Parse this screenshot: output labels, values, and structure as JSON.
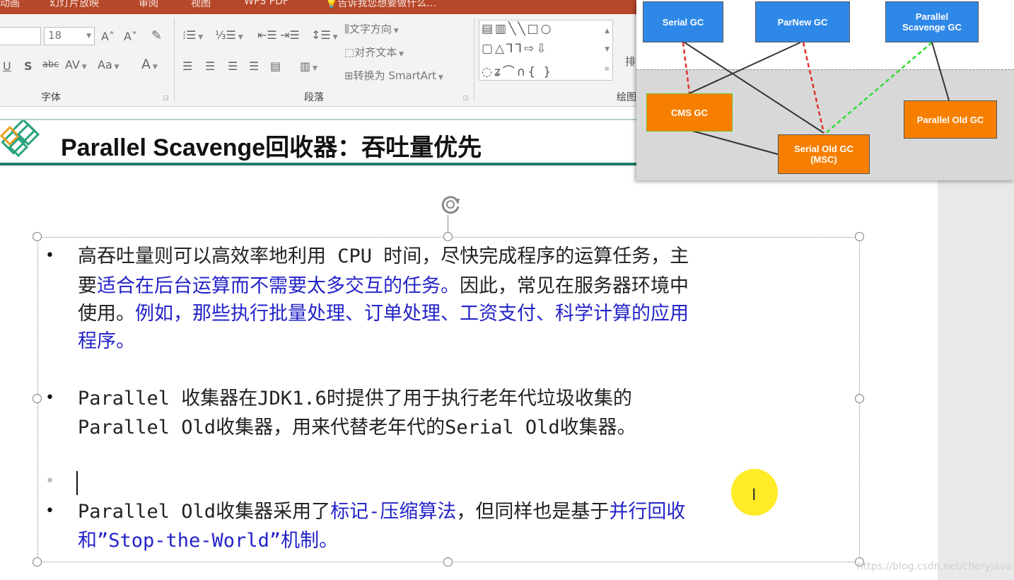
{
  "ribbon": {
    "tabs": [
      "动画",
      "幻灯片放映",
      "审阅",
      "视图",
      "WPS PDF",
      "告诉我您想要做什么..."
    ],
    "font_size": "18",
    "text_direction_label": "文字方向",
    "align_text_label": "对齐文本",
    "smartart_label": "转换为 SmartArt",
    "arrange_label_partial": "排",
    "groups": {
      "font": "字体",
      "paragraph": "段落",
      "drawing_partial": "绘图"
    },
    "font_glyphs": {
      "grow": "A˄",
      "shrink": "A˅",
      "underline": "U",
      "shadow": "S",
      "strike": "abc",
      "spacing": "AV",
      "case": "Aa",
      "color": "A"
    }
  },
  "slide": {
    "title": "Parallel Scavenge回收器：吞吐量优先",
    "paragraph1": {
      "line1": "高吞吐量则可以高效率地利用 CPU 时间，尽快完成程序的运算任务，主",
      "line2_a": "要",
      "line2_b": "适合在后台运算而不需要太多交互的任务。",
      "line2_c": "因此，常见在服务器环境中",
      "line3_a": "使用。",
      "line3_b": "例如，那些执行批量处理、订单处理、工资支付、科学计算的应用",
      "line4": "程序。"
    },
    "paragraph2": {
      "line1": "Parallel 收集器在JDK1.6时提供了用于执行老年代垃圾收集的",
      "line2": "Parallel Old收集器，用来代替老年代的Serial Old收集器。"
    },
    "paragraph3": {
      "line1_a": "Parallel Old收集器采用了",
      "line1_b": "标记-压缩算法",
      "line1_c": "，但同样也是基于",
      "line1_d": "并行回收",
      "line2": "和”Stop-the-World”机制。"
    },
    "bullet_glyph": "•"
  },
  "gc_diagram": {
    "boxes": {
      "serial": "Serial GC",
      "parnew": "ParNew GC",
      "parallel_scavenge": "Parallel Scavenge GC",
      "cms": "CMS GC",
      "serial_old": "Serial Old GC (MSC)",
      "parallel_old": "Parallel Old GC"
    },
    "colors": {
      "young": "#2e88e8",
      "old": "#f77f00",
      "red_dashed": "#e03030",
      "green_dashed": "#33dd33"
    }
  },
  "watermark": "https://blog.csdn.net/cheryjava",
  "colors": {
    "ribbon_accent": "#b7472a",
    "title_rule": "#1e7b66",
    "emphasis_blue": "#2323c8"
  }
}
